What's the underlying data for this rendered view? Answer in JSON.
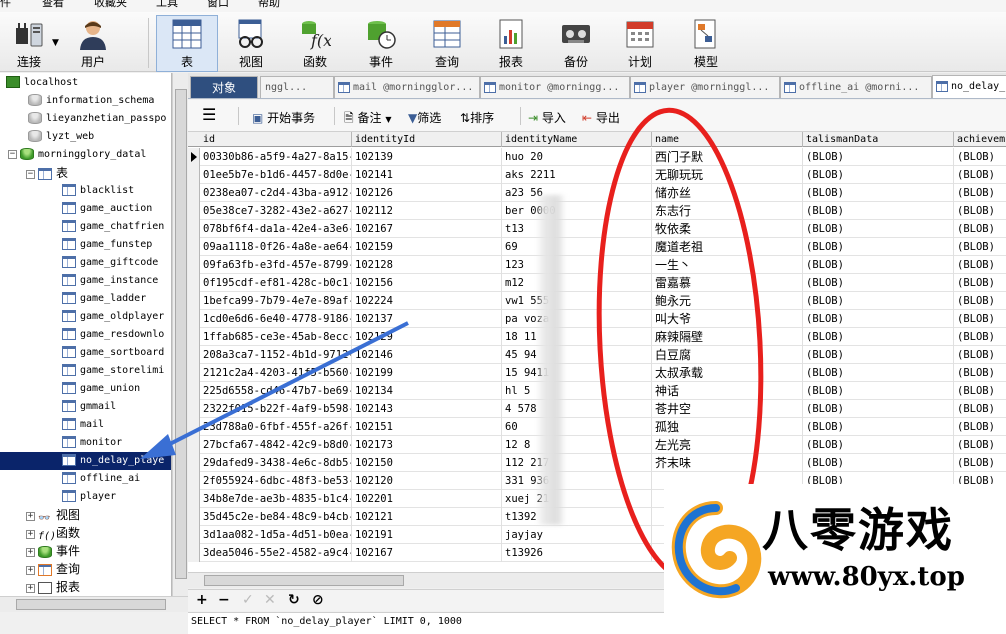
{
  "menu": [
    "件",
    "查看",
    "收藏夹",
    "工具",
    "窗口",
    "帮助"
  ],
  "toolbar": {
    "connect": "连接",
    "user": "用户",
    "table": "表",
    "view": "视图",
    "function": "函数",
    "event": "事件",
    "query": "查询",
    "report": "报表",
    "backup": "备份",
    "schedule": "计划",
    "model": "模型"
  },
  "tree": {
    "server": "localhost",
    "databases": [
      "information_schema",
      "lieyanzhetian_passpo",
      "lyzt_web",
      "morningglory_datal"
    ],
    "tables_label": "表",
    "tables": [
      "blacklist",
      "game_auction",
      "game_chatfrien",
      "game_funstep",
      "game_giftcode",
      "game_instance",
      "game_ladder",
      "game_oldplayer",
      "game_resdownlo",
      "game_sortboard",
      "game_storelimi",
      "game_union",
      "gmmail",
      "mail",
      "monitor",
      "no_delay_playe",
      "offline_ai",
      "player"
    ],
    "groups": [
      "视图",
      "函数",
      "事件",
      "查询",
      "报表"
    ]
  },
  "tabs": {
    "objects": "对象",
    "items": [
      "nggl...",
      "mail @morningglor...",
      "monitor @morningg...",
      "player @morninggl...",
      "offline_ai @morni...",
      "no_delay_..."
    ]
  },
  "grid_toolbar": {
    "begin_transaction": "开始事务",
    "memo": "备注",
    "filter": "筛选",
    "sort": "排序",
    "import": "导入",
    "export": "导出"
  },
  "grid": {
    "columns": [
      "id",
      "identityId",
      "identityName",
      "name",
      "talismanData",
      "achievem"
    ],
    "rows": [
      [
        "00330b86-a5f9-4a27-8a15-c",
        "102139",
        "huo  20",
        "西门子默",
        "(BLOB)",
        "(BLOB)"
      ],
      [
        "01ee5b7e-b1d6-4457-8d0e-2",
        "102141",
        "aks   2211",
        "无聊玩玩",
        "(BLOB)",
        "(BLOB)"
      ],
      [
        "0238ea07-c2d4-43ba-a912-c",
        "102126",
        "a23   56",
        "储亦丝",
        "(BLOB)",
        "(BLOB)"
      ],
      [
        "05e38ce7-3282-43e2-a627-c",
        "102112",
        "ber    0000",
        "东志行",
        "(BLOB)",
        "(BLOB)"
      ],
      [
        "078bf6f4-da1a-42e4-a3e6-2",
        "102167",
        "t13",
        "牧依柔",
        "(BLOB)",
        "(BLOB)"
      ],
      [
        "09aa1118-0f26-4a8e-ae64-9",
        "102159",
        "69",
        "魔道老祖",
        "(BLOB)",
        "(BLOB)"
      ],
      [
        "09fa63fb-e3fd-457e-8799-6",
        "102128",
        "123",
        "一生丶",
        "(BLOB)",
        "(BLOB)"
      ],
      [
        "0f195cdf-ef81-428c-b0c1-7",
        "102156",
        "m12",
        "雷嘉慕",
        "(BLOB)",
        "(BLOB)"
      ],
      [
        "1befca99-7b79-4e7e-89af-1",
        "102224",
        "vw1   555",
        "鲍永元",
        "(BLOB)",
        "(BLOB)"
      ],
      [
        "1cd0e6d6-6e40-4778-9186-7",
        "102137",
        "pa    voza",
        "叫大爷",
        "(BLOB)",
        "(BLOB)"
      ],
      [
        "1ffab685-ce3e-45ab-8ecc-2",
        "102129",
        "18    11",
        "麻辣隔壁",
        "(BLOB)",
        "(BLOB)"
      ],
      [
        "208a3ca7-1152-4b1d-9712-1",
        "102146",
        "45    94",
        "白豆腐",
        "(BLOB)",
        "(BLOB)"
      ],
      [
        "2121c2a4-4203-41f5-b560-2",
        "102199",
        "15    9411",
        "太叔承载",
        "(BLOB)",
        "(BLOB)"
      ],
      [
        "225d6558-cd46-47b7-be69-4",
        "102134",
        "hl    5",
        "神话",
        "(BLOB)",
        "(BLOB)"
      ],
      [
        "2322f015-b22f-4af9-b598-2",
        "102143",
        "4     578",
        "苍井空",
        "(BLOB)",
        "(BLOB)"
      ],
      [
        "23d788a0-6fbf-455f-a26f-6",
        "102151",
        "60",
        "孤独",
        "(BLOB)",
        "(BLOB)"
      ],
      [
        "27bcfa67-4842-42c9-b8d0-6",
        "102173",
        "12    8",
        "左光亮",
        "(BLOB)",
        "(BLOB)"
      ],
      [
        "29dafed9-3438-4e6c-8db5-s",
        "102150",
        "112   217",
        "芥末味",
        "(BLOB)",
        "(BLOB)"
      ],
      [
        "2f055924-6dbc-48f3-be53-2",
        "102120",
        "331   936",
        "",
        "(BLOB)",
        "(BLOB)"
      ],
      [
        "34b8e7de-ae3b-4835-b1c4-7",
        "102201",
        "xuej  21",
        "",
        "(BLOB)",
        "(BLOB)"
      ],
      [
        "35d45c2e-be84-48c9-b4cb-9",
        "102121",
        "t1392",
        "",
        "(BLOB)",
        "(BLOB)"
      ],
      [
        "3d1aa082-1d5a-4d51-b0ea-6",
        "102191",
        "jayjay",
        "",
        "(BLOB)",
        "(BLOB)"
      ],
      [
        "3dea5046-55e2-4582-a9c4-b",
        "102167",
        "t13926",
        "",
        "(BLOB)",
        "(BLOB)"
      ]
    ]
  },
  "status": "SELECT * FROM `no_delay_player` LIMIT 0, 1000",
  "watermark": {
    "brand": "八零游戏",
    "url": "www.80yx.top"
  },
  "colors": {
    "selection": "#0a246a",
    "annotation_ellipse": "#e8201d",
    "annotation_arrow": "#3a6fd4"
  }
}
